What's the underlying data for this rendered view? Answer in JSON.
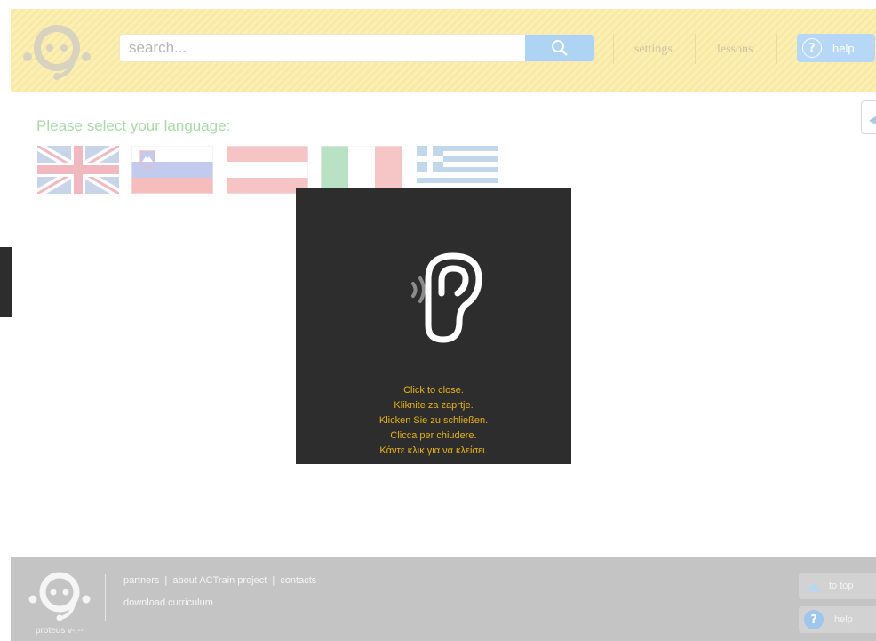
{
  "colors": {
    "header_bg": "#fbefb4",
    "accent_blue": "#aed4f4",
    "title_green": "#a8dba8",
    "modal_bg": "#2d2d2d",
    "modal_text": "#e7b21b",
    "footer_bg": "#c4c4c4"
  },
  "header": {
    "search_placeholder": "search...",
    "search_icon": "search-icon",
    "settings_label": "settings",
    "lessons_label": "lessons",
    "help_icon": "question-icon",
    "help_label": "help"
  },
  "language": {
    "title": "Please select your language:",
    "flags": [
      {
        "icon": "flag-uk-icon"
      },
      {
        "icon": "flag-slovenia-icon"
      },
      {
        "icon": "flag-austria-icon"
      },
      {
        "icon": "flag-italy-icon"
      },
      {
        "icon": "flag-greece-icon"
      }
    ]
  },
  "modal": {
    "icon": "ear-icon",
    "lines": [
      "Click to close.",
      "Kliknite za zaprtje.",
      "Klicken Sie zu schließen.",
      "Clicca per chiudere.",
      "Κάντε κλικ για να κλείσει."
    ]
  },
  "footer": {
    "version": "proteus v-.--",
    "links": [
      "partners",
      "about ACTrain project",
      "contacts"
    ],
    "download": "download curriculum",
    "totop_label": "to top",
    "help_label": "help"
  }
}
